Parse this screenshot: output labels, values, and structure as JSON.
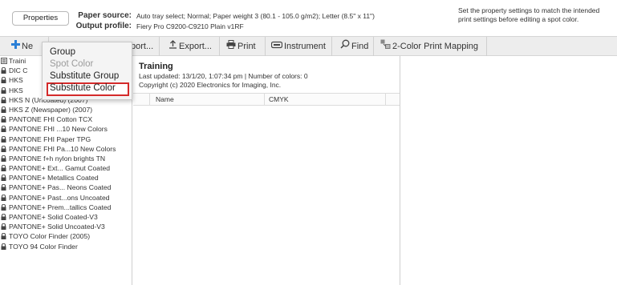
{
  "properties_button": "Properties",
  "paper_source_label": "Paper source:",
  "paper_source_value": "Auto tray select; Normal; Paper weight 3 (80.1 - 105.0 g/m2); Letter (8.5\" x 11\")",
  "output_profile_label": "Output profile:",
  "output_profile_value": "Fiery Pro C9200-C9210 Plain v1RF",
  "right_note": "Set the property settings to match the intended print settings before editing a spot color.",
  "toolbar": {
    "new": "Ne",
    "import": "port...",
    "export": "Export...",
    "print": "Print",
    "instrument": "Instrument",
    "find": "Find",
    "mapping": "2-Color Print Mapping"
  },
  "menu": {
    "items": [
      {
        "label": "Group",
        "disabled": false
      },
      {
        "label": "Spot Color",
        "disabled": true
      },
      {
        "label": "Substitute Group",
        "disabled": false
      },
      {
        "label": "Substitute Color",
        "disabled": false,
        "highlighted": true
      }
    ]
  },
  "library_list": [
    "Traini",
    "DIC C",
    "HKS",
    "HKS",
    "HKS N (Uncoated) (2007)",
    "HKS Z (Newspaper) (2007)",
    "PANTONE FHI Cotton TCX",
    "PANTONE FHI ...10 New Colors",
    "PANTONE FHI Paper TPG",
    "PANTONE FHI Pa...10 New Colors",
    "PANTONE f+h nylon brights TN",
    "PANTONE+ Ext... Gamut Coated",
    "PANTONE+ Metallics Coated",
    "PANTONE+ Pas... Neons Coated",
    "PANTONE+ Past...ons Uncoated",
    "PANTONE+ Prem...tallics Coated",
    "PANTONE+ Solid Coated-V3",
    "PANTONE+ Solid Uncoated-V3",
    "TOYO Color Finder (2005)",
    "TOYO 94 Color Finder"
  ],
  "library": {
    "title": "Training",
    "updated": "Last updated: 13/1/20, 1:07:34 pm | Number of colors: 0",
    "copyright": "Copyright (c) 2020 Electronics for Imaging, Inc."
  },
  "table": {
    "col_name": "Name",
    "col_cmyk": "CMYK"
  },
  "colors": {
    "accent_blue": "#2a7fd6",
    "highlight_red": "#d42a2a",
    "toolbar_bg": "#ededed"
  }
}
